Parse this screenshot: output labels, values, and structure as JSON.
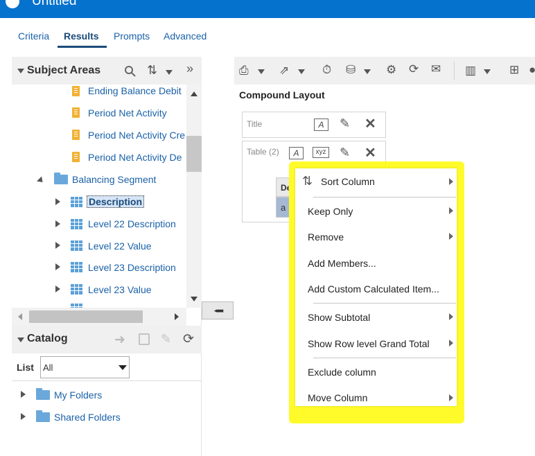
{
  "window": {
    "title": "Untitled"
  },
  "tabs": [
    "Criteria",
    "Results",
    "Prompts",
    "Advanced"
  ],
  "subject_areas": {
    "title": "Subject Areas",
    "tree": [
      {
        "label": "Ending Balance Debit",
        "icon": "measure-icon"
      },
      {
        "label": "Period Net Activity",
        "icon": "measure-icon"
      },
      {
        "label": "Period Net Activity Cre",
        "icon": "measure-icon"
      },
      {
        "label": "Period Net Activity De",
        "icon": "measure-icon"
      },
      {
        "label": "Balancing Segment",
        "icon": "folder-icon"
      },
      {
        "label": "Description",
        "icon": "column-icon",
        "selected": true
      },
      {
        "label": "Level 22 Description",
        "icon": "column-icon"
      },
      {
        "label": "Level 22 Value",
        "icon": "column-icon"
      },
      {
        "label": "Level 23 Description",
        "icon": "column-icon"
      },
      {
        "label": "Level 23 Value",
        "icon": "column-icon"
      }
    ]
  },
  "splitter": {
    "glyph": "◂◂◂◂◂◂◂"
  },
  "catalog": {
    "title": "Catalog",
    "list_label": "List",
    "list_value": "All",
    "folders": [
      "My Folders",
      "Shared Folders"
    ]
  },
  "layout": {
    "heading": "Compound Layout",
    "title_view": "Title",
    "table_view": "Table (2)",
    "table_header": "De",
    "table_cell": "a",
    "xyz": "xyz"
  },
  "context_menu": {
    "highlight_color": "#fffb2a",
    "items": [
      "Sort Column",
      "Keep Only",
      "Remove",
      "Add Members...",
      "Add Custom Calculated Item...",
      "Show Subtotal",
      "Show Row level Grand Total",
      "Exclude column",
      "Move Column"
    ]
  },
  "colors": {
    "topbar": "#0572ce",
    "link": "#1a61a8"
  }
}
